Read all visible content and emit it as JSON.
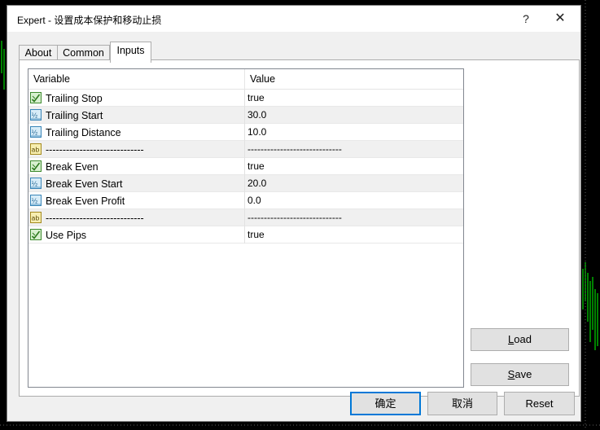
{
  "window": {
    "title": "Expert - 设置成本保护和移动止损",
    "help_label": "?",
    "close_label": "✕"
  },
  "tabs": [
    {
      "label": "About"
    },
    {
      "label": "Common"
    },
    {
      "label": "Inputs",
      "active": true
    }
  ],
  "grid": {
    "columns": {
      "variable": "Variable",
      "value": "Value"
    },
    "rows": [
      {
        "icon": "bool-icon",
        "name": "Trailing Stop",
        "value": "true"
      },
      {
        "icon": "double-icon",
        "name": "Trailing Start",
        "value": "30.0"
      },
      {
        "icon": "double-icon",
        "name": "Trailing Distance",
        "value": "10.0"
      },
      {
        "icon": "string-icon",
        "name": "-----------------------------",
        "value": "-----------------------------"
      },
      {
        "icon": "bool-icon",
        "name": "Break Even",
        "value": "true"
      },
      {
        "icon": "double-icon",
        "name": "Break Even Start",
        "value": "20.0"
      },
      {
        "icon": "double-icon",
        "name": "Break Even Profit",
        "value": "0.0"
      },
      {
        "icon": "string-icon",
        "name": "-----------------------------",
        "value": "-----------------------------"
      },
      {
        "icon": "bool-icon",
        "name": "Use Pips",
        "value": "true"
      }
    ]
  },
  "buttons": {
    "load": {
      "mnemonic": "L",
      "rest": "oad"
    },
    "save": {
      "mnemonic": "S",
      "rest": "ave"
    },
    "ok": "确定",
    "cancel": "取消",
    "reset": "Reset"
  },
  "colors": {
    "chart_background": "#000000",
    "chart_candles": "#00ff00",
    "accent_focus": "#0078d7"
  }
}
